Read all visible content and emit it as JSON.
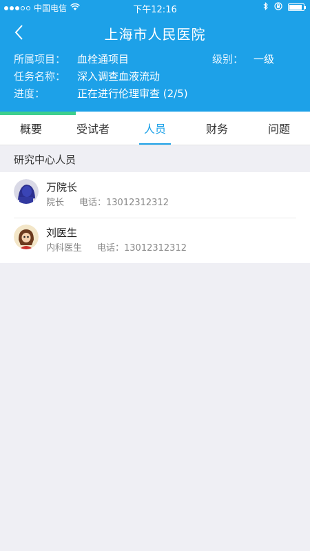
{
  "status_bar": {
    "carrier": "中国电信",
    "time": "下午12:16"
  },
  "nav": {
    "title": "上海市人民医院",
    "back_icon": "chevron-left-icon"
  },
  "info": {
    "project_label": "所属项目：",
    "project_value": "血栓通项目",
    "level_label": "级别：",
    "level_value": "一级",
    "task_label": "任务名称：",
    "task_value": "深入调查血液流动",
    "progress_label": "进度：",
    "progress_value": "正在进行伦理审查 (2/5)",
    "progress_fraction": 0.4
  },
  "tabs": [
    {
      "label": "概要",
      "active": false
    },
    {
      "label": "受试者",
      "active": false
    },
    {
      "label": "人员",
      "active": true
    },
    {
      "label": "财务",
      "active": false
    },
    {
      "label": "问题",
      "active": false
    }
  ],
  "section": {
    "title": "研究中心人员"
  },
  "people": [
    {
      "name": "万院长",
      "role": "院长",
      "phone": "电话：13012312312"
    },
    {
      "name": "刘医生",
      "role": "内科医生",
      "phone": "电话：13012312312"
    }
  ],
  "colors": {
    "primary": "#1da1e8",
    "progress": "#3ecf8e",
    "background": "#efeff4"
  }
}
